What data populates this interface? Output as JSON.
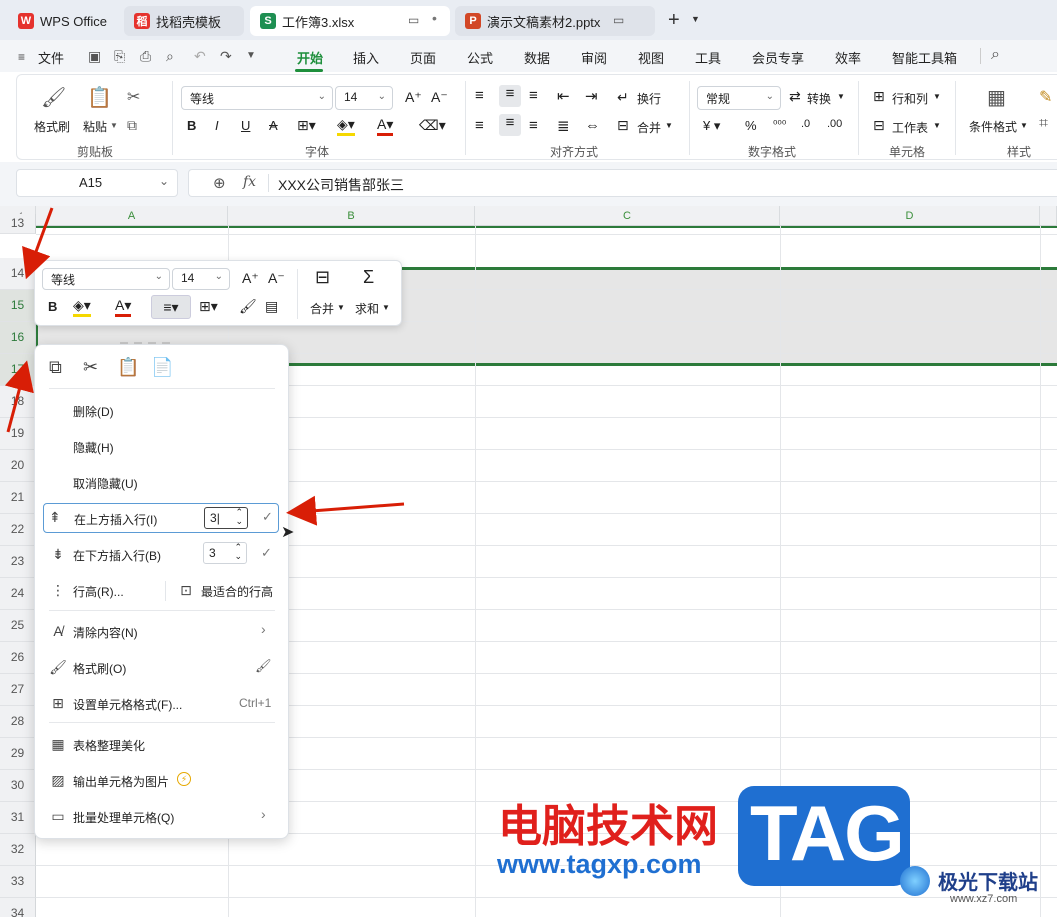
{
  "tabs": [
    {
      "label": "WPS Office",
      "icon": "wps-logo-icon"
    },
    {
      "label": "找稻壳模板",
      "icon": "docer-icon"
    },
    {
      "label": "工作簿3.xlsx",
      "icon": "spreadsheet-icon",
      "badge": "S"
    },
    {
      "label": "演示文稿素材2.pptx",
      "icon": "presentation-icon",
      "badge": "P"
    }
  ],
  "menu": {
    "file": "文件",
    "items": [
      "开始",
      "插入",
      "页面",
      "公式",
      "数据",
      "审阅",
      "视图",
      "工具",
      "会员专享",
      "效率",
      "智能工具箱"
    ],
    "active": "开始"
  },
  "ribbon": {
    "format_painter": "格式刷",
    "paste": "粘贴",
    "clipboard": "剪贴板",
    "font_name": "等线",
    "font_size": "14",
    "font_group": "字体",
    "wrap": "换行",
    "merge": "合并",
    "align_group": "对齐方式",
    "number_format": "常规",
    "convert": "转换",
    "number_group": "数字格式",
    "row_col": "行和列",
    "worksheet": "工作表",
    "cell_group": "单元格",
    "cond_format": "条件格式",
    "style_group": "样式"
  },
  "formula_bar": {
    "cell_ref": "A15",
    "fx": "fx",
    "content": "XXX公司销售部张三"
  },
  "columns": [
    "A",
    "B",
    "C",
    "D"
  ],
  "rows": [
    "13",
    "14",
    "15",
    "16",
    "17",
    "18",
    "19",
    "20",
    "21",
    "22",
    "23",
    "24",
    "25",
    "26",
    "27",
    "28",
    "29",
    "30",
    "31",
    "32",
    "33",
    "34"
  ],
  "mini_toolbar": {
    "font_name": "等线",
    "font_size": "14",
    "merge": "合并",
    "sum": "求和"
  },
  "context_menu": {
    "delete": "删除(D)",
    "hide": "隐藏(H)",
    "unhide": "取消隐藏(U)",
    "insert_above": "在上方插入行(I)",
    "insert_above_value": "3",
    "insert_below": "在下方插入行(B)",
    "insert_below_value": "3",
    "row_height": "行高(R)...",
    "best_fit": "最适合的行高",
    "clear": "清除内容(N)",
    "format_painter": "格式刷(O)",
    "cell_format": "设置单元格格式(F)...",
    "cell_format_shortcut": "Ctrl+1",
    "beautify": "表格整理美化",
    "export_image": "输出单元格为图片",
    "batch": "批量处理单元格(Q)"
  },
  "watermark": {
    "site_cn": "电脑技术网",
    "site_url": "www.tagxp.com",
    "tag": "TAG",
    "brand2": "极光下载站",
    "brand2_url": "www.xz7.com"
  },
  "colors": {
    "accent": "#2c7a3a",
    "arrow": "#d81e06",
    "wm_red": "#e0201c",
    "wm_blue": "#1f6fd1"
  }
}
